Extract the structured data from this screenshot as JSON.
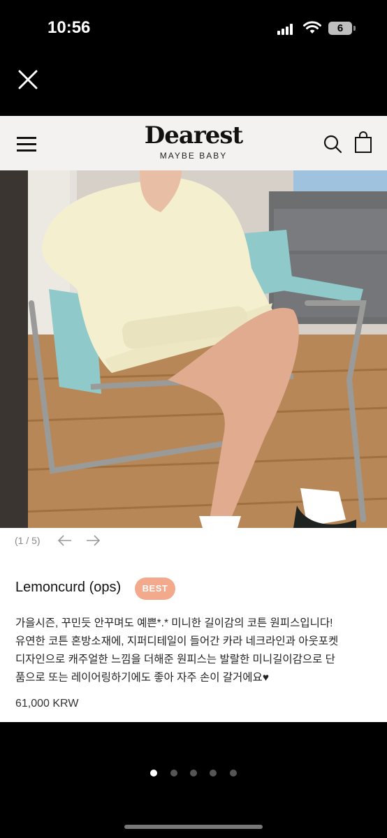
{
  "status_bar": {
    "time": "10:56",
    "battery": "6"
  },
  "header": {
    "brand": "Dearest",
    "tagline": "MAYBE BABY"
  },
  "gallery": {
    "current": "(1 / 5)"
  },
  "product": {
    "title": "Lemoncurd (ops)",
    "badge": "BEST",
    "description": [
      "가을시즌, 꾸민듯 안꾸며도 예쁜*.* 미니한 길이감의 코튼 원피스입니다!",
      "유연한 코튼 혼방소재에, 지퍼디테일이 들어간 카라 네크라인과 아웃포켓",
      "디자인으로 캐주얼한 느낌을 더해준 원피스는 발랄한 미니길이감으로 단",
      "품으로 또는 레이어링하기에도 좋아 자주 손이 갈거에요♥"
    ],
    "price": "61,000 KRW"
  },
  "carousel": {
    "total": 5,
    "active_index": 0
  },
  "colors": {
    "badge": "#f2a98c",
    "header_bg": "#f4f2f0",
    "background": "#000000"
  },
  "icons": [
    "close-icon",
    "menu-icon",
    "search-icon",
    "shopping-bag-icon",
    "arrow-left-icon",
    "arrow-right-icon"
  ]
}
